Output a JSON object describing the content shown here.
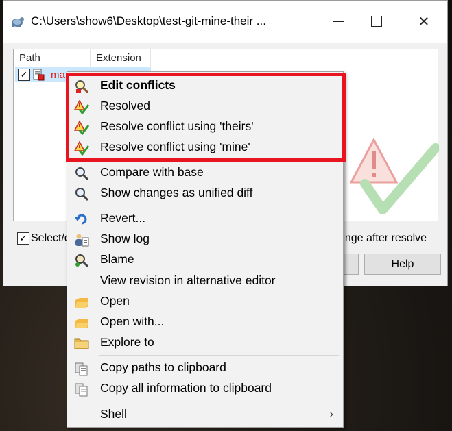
{
  "window": {
    "title": "C:\\Users\\show6\\Desktop\\test-git-mine-their ...",
    "controls": {
      "minimize": "",
      "maximize": "",
      "close": "✕"
    }
  },
  "list": {
    "columns": [
      "Path",
      "Extension"
    ],
    "rows": [
      {
        "checked": "✓",
        "name": "ma"
      }
    ]
  },
  "footer": {
    "select_check": "✓",
    "select_label": "Select/d",
    "resolve_label": "ange after resolve",
    "help_button": "Help"
  },
  "context_menu": {
    "items": [
      {
        "label": "Edit conflicts",
        "icon": "edit-conflict-icon",
        "bold": true
      },
      {
        "label": "Resolved",
        "icon": "resolved-icon"
      },
      {
        "label": "Resolve conflict using 'theirs'",
        "icon": "resolved-icon"
      },
      {
        "label": "Resolve conflict using 'mine'",
        "icon": "resolved-icon"
      },
      {
        "label": "Compare with base",
        "icon": "magnifier-icon"
      },
      {
        "label": "Show changes as unified diff",
        "icon": "magnifier-icon"
      },
      {
        "label": "Revert...",
        "icon": "revert-icon"
      },
      {
        "label": "Show log",
        "icon": "log-icon"
      },
      {
        "label": "Blame",
        "icon": "blame-icon"
      },
      {
        "label": "View revision in alternative editor",
        "icon": ""
      },
      {
        "label": "Open",
        "icon": "open-icon"
      },
      {
        "label": "Open with...",
        "icon": "open-icon"
      },
      {
        "label": "Explore to",
        "icon": "folder-icon"
      },
      {
        "label": "Copy paths to clipboard",
        "icon": "clipboard-icon"
      },
      {
        "label": "Copy all information to clipboard",
        "icon": "clipboard-icon"
      },
      {
        "label": "Shell",
        "icon": "",
        "submenu": "›"
      }
    ]
  },
  "colors": {
    "highlight": "#e8141f",
    "conflict_file": "#e0201a",
    "selection": "#cce8ff",
    "menu_bg": "#f2f2f2"
  }
}
